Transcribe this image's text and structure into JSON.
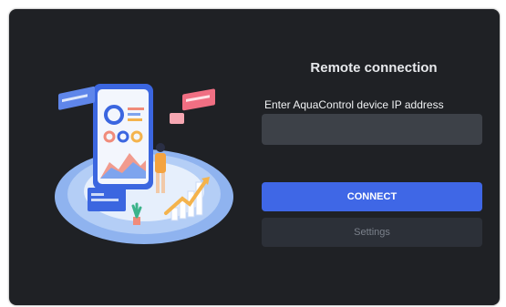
{
  "dialog": {
    "title": "Remote connection",
    "ip_label": "Enter AquaControl device IP address",
    "ip_value": "",
    "connect_label": "CONNECT",
    "settings_label": "Settings"
  },
  "colors": {
    "background": "#1f2125",
    "input": "#3d4148",
    "primary_button": "#3f67e6",
    "secondary_button": "#2c3038"
  },
  "illustration": {
    "icon": "connected-devices-illustration"
  }
}
